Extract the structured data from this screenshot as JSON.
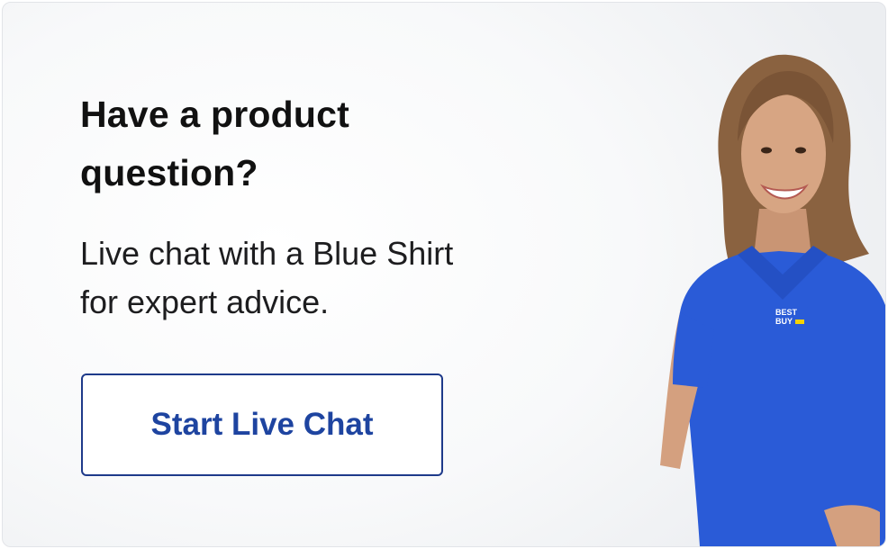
{
  "promo": {
    "headline_line1": "Have a product",
    "headline_line2": "question?",
    "subtext_line1": "Live chat with a Blue Shirt",
    "subtext_line2": "for expert advice.",
    "button_label": "Start Live Chat",
    "logo_text": "BEST BUY"
  },
  "colors": {
    "button_text": "#1e44a0",
    "button_border": "#1e3a8a",
    "shirt": "#2a5bd7",
    "logo_tag": "#f6d200"
  },
  "image": {
    "subject": "woman-in-blue-shirt-photo"
  }
}
